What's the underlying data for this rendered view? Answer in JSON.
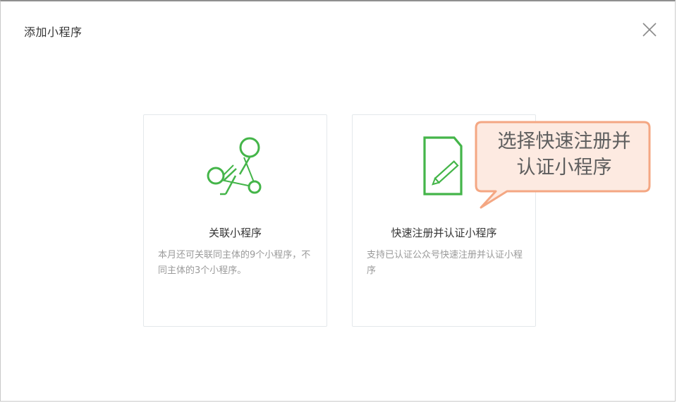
{
  "dialog": {
    "title": "添加小程序"
  },
  "cards": [
    {
      "title": "关联小程序",
      "description": "本月还可关联同主体的9个小程序，不同主体的3个小程序。",
      "icon": "network-nodes-icon"
    },
    {
      "title": "快速注册并认证小程序",
      "description": "支持已认证公众号快速注册并认证小程序",
      "icon": "document-pencil-icon"
    }
  ],
  "callout": {
    "line1": "选择快速注册并",
    "line2": "认证小程序"
  },
  "colors": {
    "accent": "#44b549",
    "callout_fill": "#fdeae1",
    "callout_border": "#f4a783"
  }
}
